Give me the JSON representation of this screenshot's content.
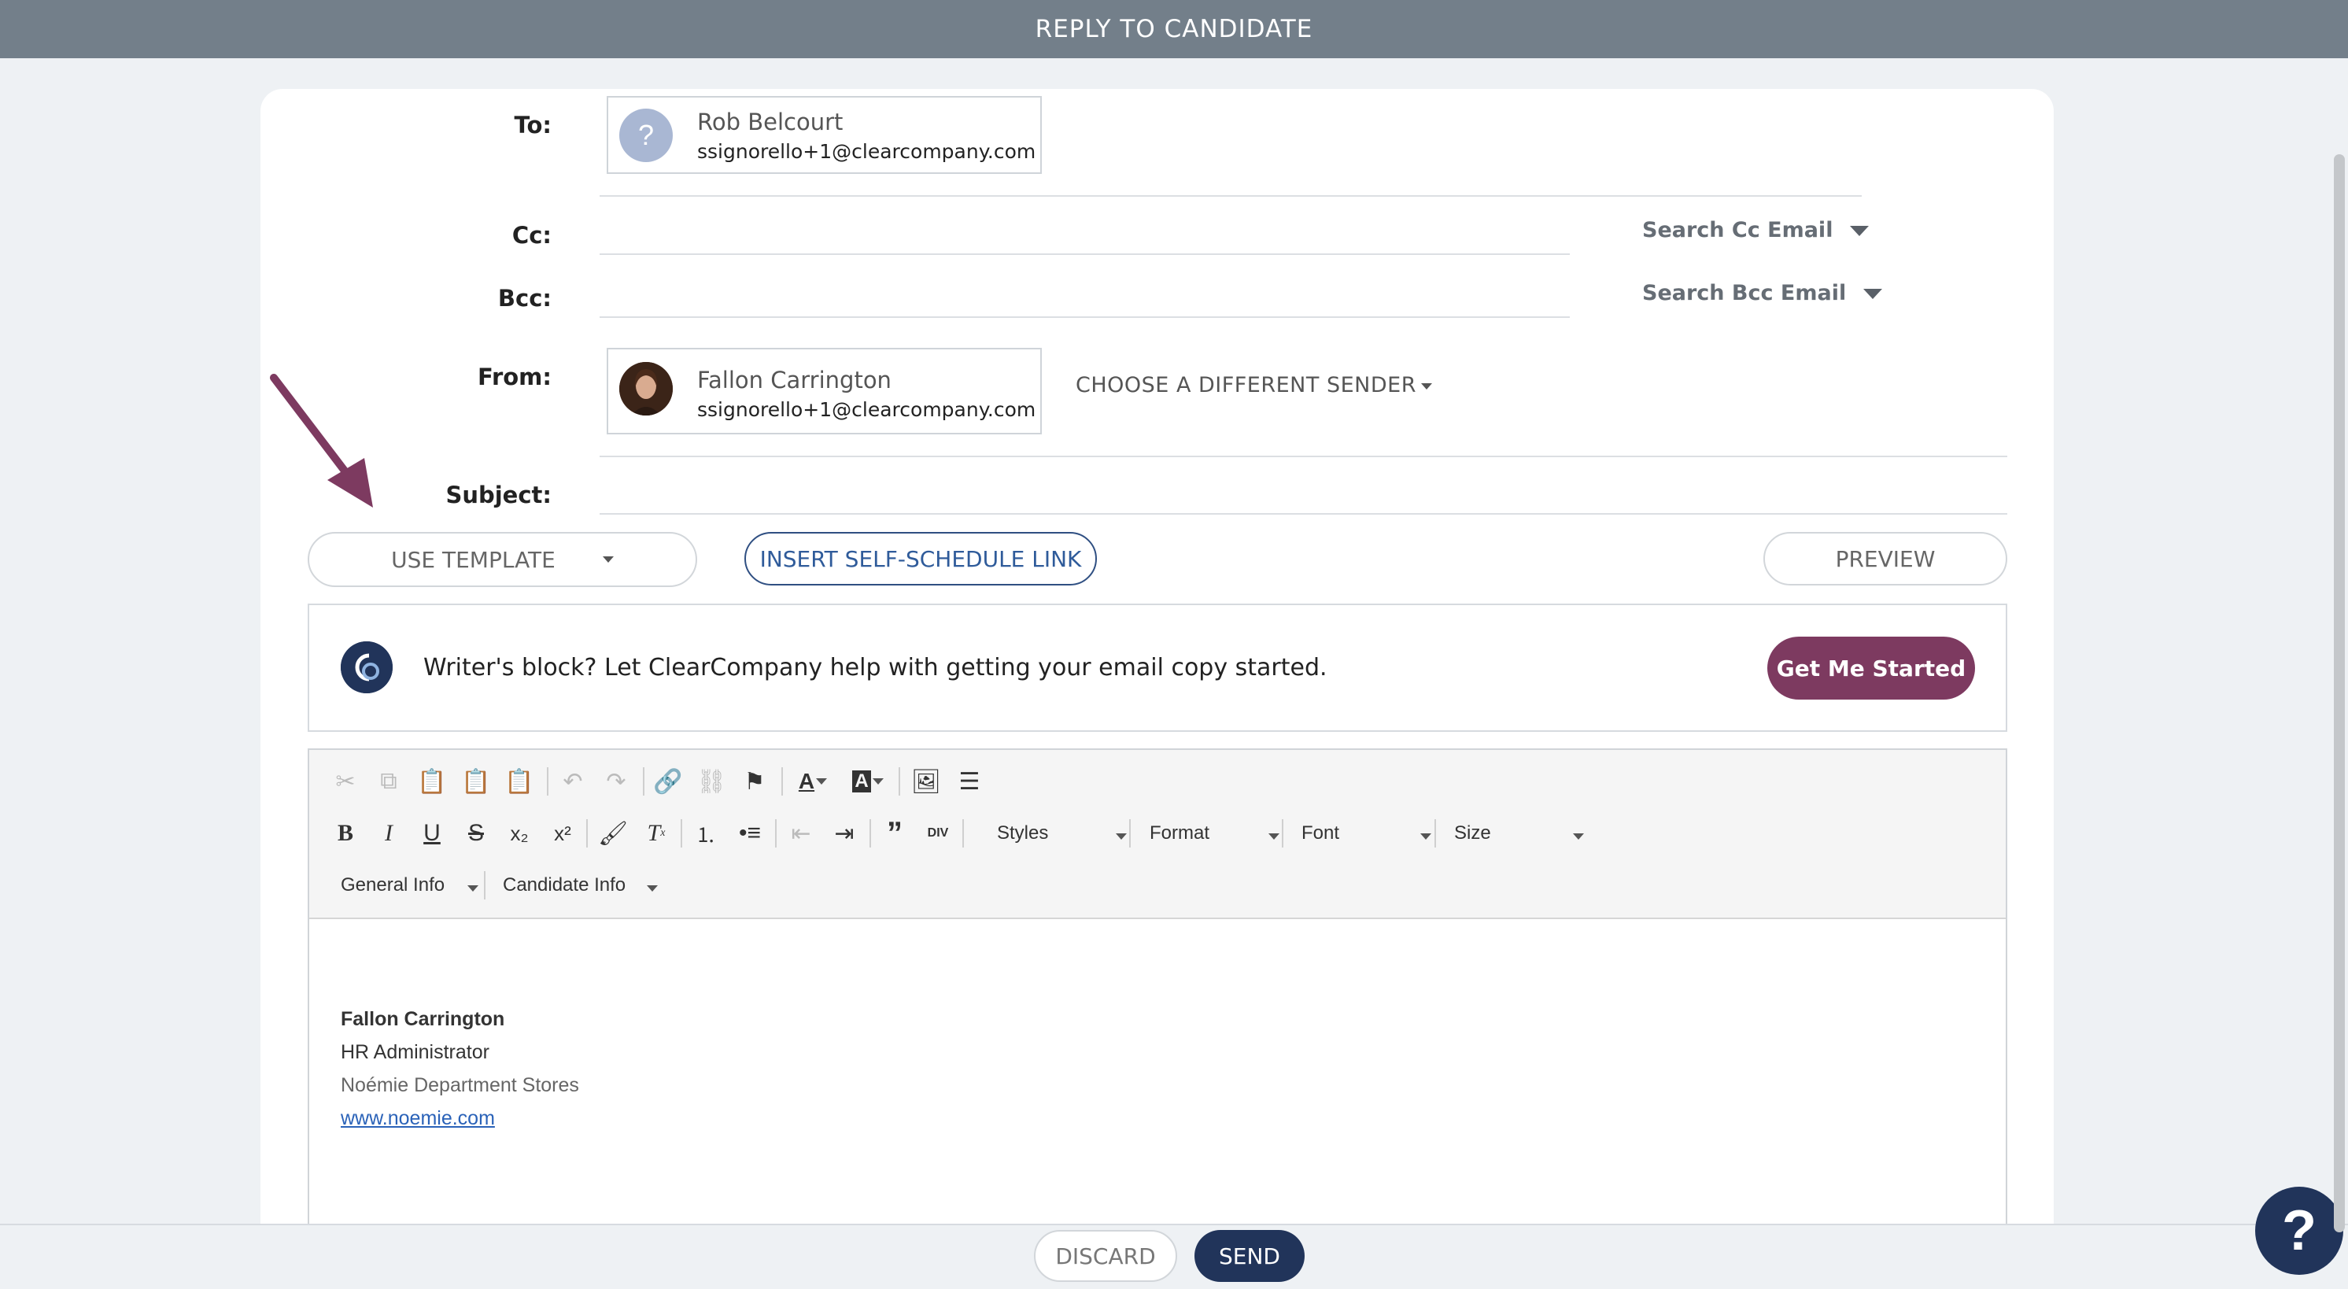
{
  "header": {
    "title": "REPLY TO CANDIDATE"
  },
  "fields": {
    "to_label": "To:",
    "cc_label": "Cc:",
    "bcc_label": "Bcc:",
    "from_label": "From:",
    "subject_label": "Subject:"
  },
  "to_recipient": {
    "name": "Rob Belcourt",
    "email": "ssignorello+1@clearcompany.com",
    "avatar_glyph": "?"
  },
  "cc_search": "Search Cc Email",
  "bcc_search": "Search Bcc Email",
  "from_sender": {
    "name": "Fallon Carrington",
    "email": "ssignorello+1@clearcompany.com"
  },
  "choose_sender": "CHOOSE A DIFFERENT SENDER",
  "subject_value": "",
  "actions": {
    "use_template": "USE TEMPLATE",
    "insert_link": "INSERT SELF-SCHEDULE LINK",
    "preview": "PREVIEW"
  },
  "assist": {
    "logo_text": "C",
    "text": "Writer's block? Let ClearCompany help with getting your email copy started.",
    "button": "Get Me Started"
  },
  "toolbar": {
    "row1": [
      "cut-icon",
      "copy-icon",
      "paste-icon",
      "paste-text-icon",
      "paste-word-icon",
      "undo-icon",
      "redo-icon",
      "link-icon",
      "unlink-icon",
      "anchor-icon",
      "text-color-icon",
      "bg-color-icon",
      "image-icon",
      "horizontal-line-icon"
    ],
    "row2": [
      "bold-icon",
      "italic-icon",
      "underline-icon",
      "strikethrough-icon",
      "subscript-icon",
      "superscript-icon",
      "copy-format-icon",
      "remove-format-icon",
      "numbered-list-icon",
      "bulleted-list-icon",
      "decrease-indent-icon",
      "increase-indent-icon",
      "blockquote-icon",
      "div-icon"
    ],
    "styles": "Styles",
    "format": "Format",
    "font": "Font",
    "size": "Size",
    "general_info": "General Info",
    "candidate_info": "Candidate Info"
  },
  "signature": {
    "name": "Fallon Carrington",
    "title": "HR Administrator",
    "company": "Noémie Department Stores",
    "website": "www.noemie.com "
  },
  "footer": {
    "discard": "DISCARD",
    "send": "SEND"
  },
  "help_glyph": "?",
  "colors": {
    "header": "#737f8a",
    "accent_purple": "#7d3a60",
    "navy": "#21345a",
    "link_blue": "#2f5b9a"
  }
}
